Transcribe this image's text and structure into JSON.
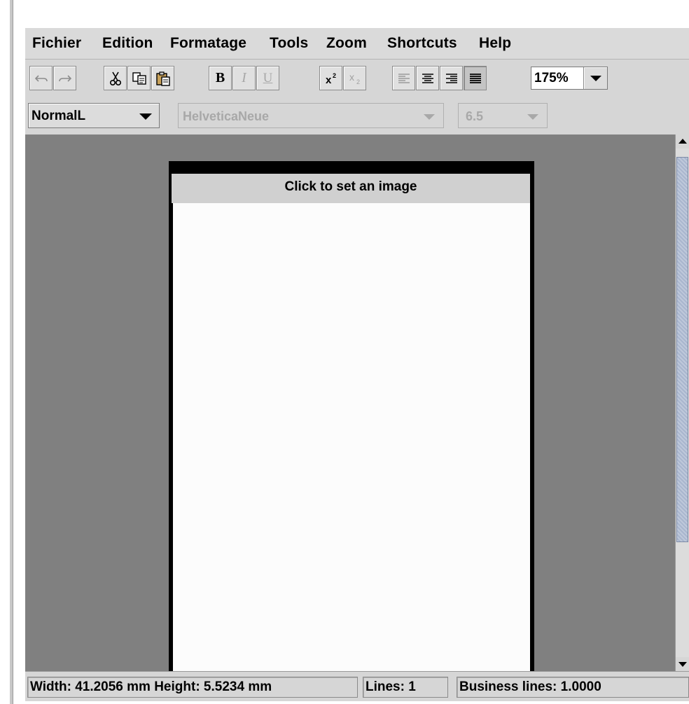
{
  "menubar": {
    "items": [
      {
        "label": "Fichier"
      },
      {
        "label": "Edition"
      },
      {
        "label": "Formatage"
      },
      {
        "label": "Tools"
      },
      {
        "label": "Zoom"
      },
      {
        "label": "Shortcuts"
      },
      {
        "label": "Help"
      }
    ]
  },
  "toolbar": {
    "undo_icon": "undo-icon",
    "redo_icon": "redo-icon",
    "cut_icon": "scissors-icon",
    "copy_icon": "copy-icon",
    "paste_icon": "paste-icon",
    "bold_label": "B",
    "italic_label": "I",
    "underline_label": "U",
    "superscript_icon": "superscript-icon",
    "subscript_icon": "subscript-icon",
    "align_icons": [
      "align-left-icon",
      "align-center-icon",
      "align-right-icon",
      "align-justify-icon"
    ],
    "zoom_value": "175%"
  },
  "formatbar": {
    "style_value": "NormalL",
    "font_value": "HelveticaNeue",
    "size_value": "6.5"
  },
  "canvas": {
    "image_placeholder": "Click to set an image"
  },
  "statusbar": {
    "dimensions": "Width: 41.2056 mm   Height: 5.5234 mm",
    "lines": "Lines: 1",
    "business_lines": "Business lines: 1.0000"
  },
  "colors": {
    "canvas_bg": "#808080",
    "chrome_bg": "#d6d6d6",
    "scroll_thumb": "#a9b6ce"
  }
}
